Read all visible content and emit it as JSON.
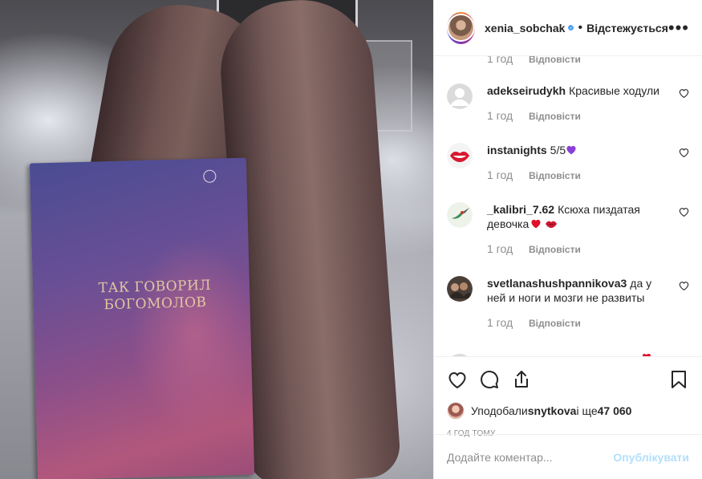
{
  "post": {
    "book_title_line1": "ТАК ГОВОРИЛ",
    "book_title_line2": "БОГОМОЛОВ"
  },
  "header": {
    "username": "xenia_sobchak",
    "separator": "•",
    "follow_label": "Відстежується",
    "more_label": "•••"
  },
  "partial_comment": {
    "time": "1 год",
    "reply_label": "Відповісти"
  },
  "comments": [
    {
      "username": "adekseirudykh",
      "text": "Красивые ходули",
      "time": "1 год",
      "reply_label": "Відповісти"
    },
    {
      "username": "instanights",
      "text": "5/5",
      "time": "1 год",
      "reply_label": "Відповісти"
    },
    {
      "username": "_kalibri_7.62",
      "text": "Ксюха пиздатая девочка",
      "time": "1 год",
      "reply_label": "Відповісти"
    },
    {
      "username": "svetlanashushpannikova3",
      "text": "да у ней и ноги и мозги не развиты",
      "time": "1 год",
      "reply_label": "Відповісти"
    }
  ],
  "likes": {
    "prefix": "Уподобали ",
    "user": "snytkova",
    "middle": " і ще ",
    "count": "47 060"
  },
  "timestamp": "4 год тому",
  "add_comment": {
    "placeholder": "Додайте коментар...",
    "publish_label": "Опублікувати"
  },
  "colors": {
    "verified": "#3897f0",
    "publish_disabled": "#b2dffc",
    "secondary_text": "#8e8e8e",
    "heart_red": "#ed4956"
  },
  "icons": [
    "verified-badge-icon",
    "more-options-icon",
    "like-heart-icon",
    "comment-bubble-icon",
    "share-icon",
    "bookmark-icon",
    "purple-heart-emoji-icon",
    "red-heart-emoji-icon",
    "lips-emoji-icon"
  ]
}
